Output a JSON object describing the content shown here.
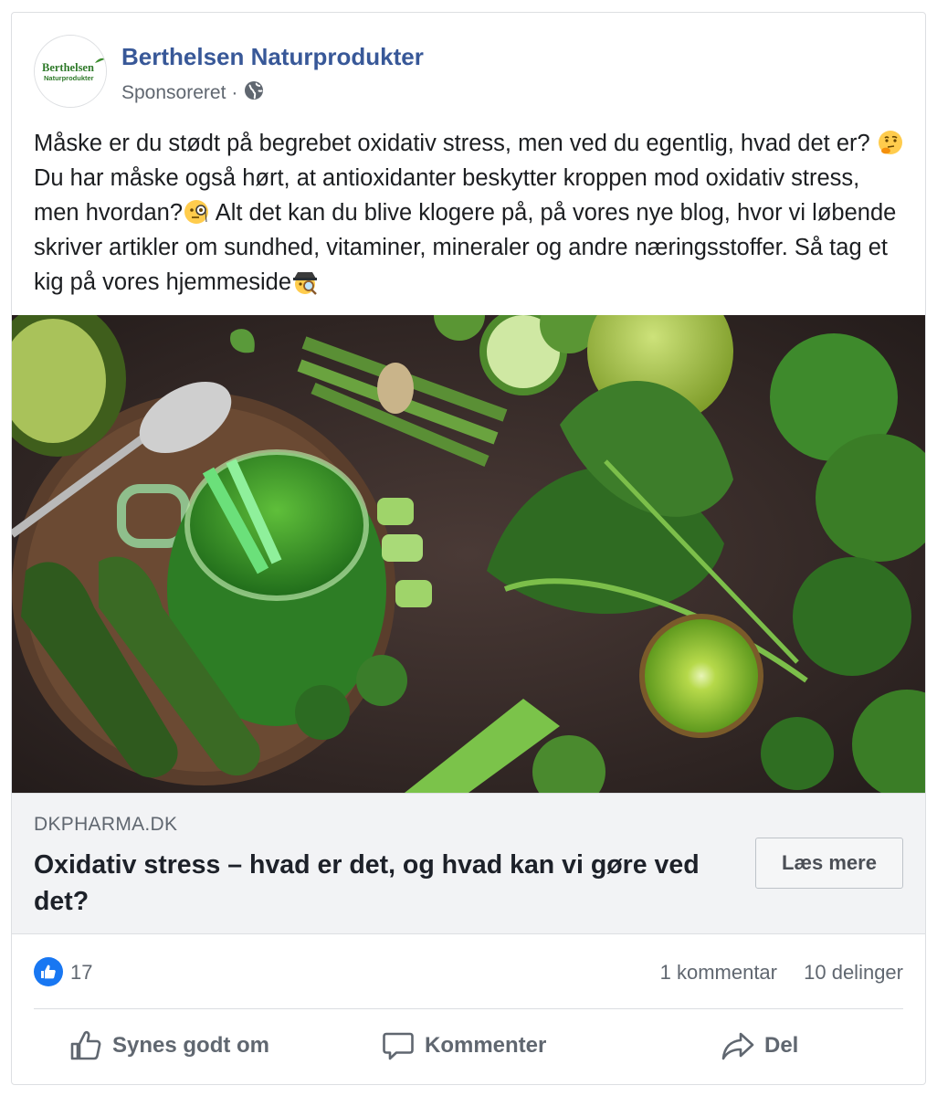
{
  "post": {
    "page_name": "Berthelsen Naturprodukter",
    "sponsored": "Sponsoreret",
    "separator": "·",
    "logo_text_1": "Berthelsen",
    "logo_text_2": "Naturprodukter",
    "text_1": "Måske er du stødt på begrebet oxidativ stress, men ved du egentlig, hvad det er? ",
    "text_2": " Du har måske også hørt, at antioxidanter beskytter kroppen mod oxidativ stress, men hvordan?",
    "text_3": " Alt det kan du blive klogere på, på vores nye blog, hvor vi løbende skriver artikler om sundhed, vitaminer, mineraler og andre næringsstoffer. Så tag et kig på vores hjemmeside",
    "emojis": [
      "thinking-face",
      "face-with-monocle",
      "detective"
    ]
  },
  "link": {
    "domain": "DKPHARMA.DK",
    "title": "Oxidativ stress – hvad er det, og hvad kan vi gøre ved det?",
    "cta": "Læs mere"
  },
  "stats": {
    "likes": "17",
    "comments": "1 kommentar",
    "shares": "10 delinger"
  },
  "actions": {
    "like": "Synes godt om",
    "comment": "Kommenter",
    "share": "Del"
  },
  "colors": {
    "link_blue": "#385898",
    "like_blue": "#1877f2",
    "muted": "#606770",
    "preview_bg": "#f2f3f5"
  }
}
